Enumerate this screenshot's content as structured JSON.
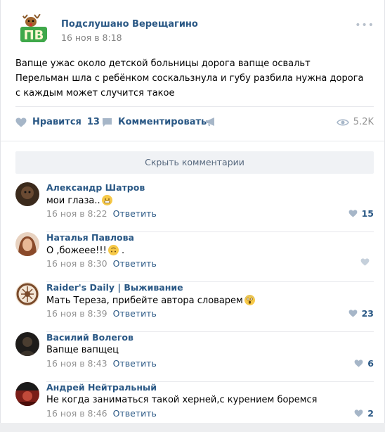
{
  "post": {
    "group_name": "Подслушано Верещагино",
    "logo_text": "ПВ",
    "time": "16 ноя в 8:18",
    "text": "Вапще ужас около детской больницы дорога вапще освальт Перельман шла с ребёнком соскальзнула и губу разбила нужна дорога с каждым может случится такое",
    "like_label": "Нравится",
    "like_count": "13",
    "comment_label": "Комментировать",
    "views": "5.2K",
    "more": "•••"
  },
  "comments_toggle": "Скрыть комментарии",
  "reply_label": "Ответить",
  "comments": [
    {
      "author": "Александр Шатров",
      "text": "мои глаза..",
      "emoji": "grin",
      "time": "16 ноя в 8:22",
      "likes": "15",
      "avatar_color": "#4a3524"
    },
    {
      "author": "Наталья Павлова",
      "text": "О ,божеее!!!",
      "emoji": "upside",
      "tail": " .",
      "time": "16 ноя в 8:30",
      "likes": "",
      "avatar_color": "#c99a78"
    },
    {
      "author": "Raider's Daily | Выживание",
      "text": "Мать Тереза, прибейте автора словарем",
      "emoji": "scream",
      "time": "16 ноя в 8:39",
      "likes": "23",
      "avatar_color": "#7a4a2a"
    },
    {
      "author": "Василий Волегов",
      "text": "Вапще вапщец",
      "time": "16 ноя в 8:43",
      "likes": "6",
      "avatar_color": "#2e2a26"
    },
    {
      "author": "Андрей Нейтральный",
      "text": "Не когда заниматься такой херней,с курением боремся",
      "time": "16 ноя в 8:46",
      "likes": "2",
      "avatar_color": "#8a2a20"
    }
  ]
}
